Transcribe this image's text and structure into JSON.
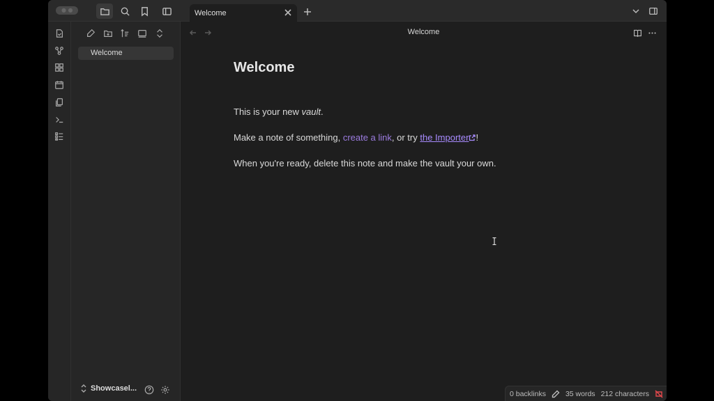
{
  "tabs": [
    {
      "label": "Welcome"
    }
  ],
  "sidebar": {
    "files": [
      {
        "label": "Welcome"
      }
    ],
    "vault_name": "Showcasel..."
  },
  "view": {
    "title": "Welcome"
  },
  "note": {
    "heading": "Welcome",
    "p1_prefix": "This is your new ",
    "p1_em": "vault",
    "p1_suffix": ".",
    "p2_prefix": "Make a note of something, ",
    "p2_link_internal": "create a link",
    "p2_mid": ", or try ",
    "p2_link_external": "the Importer",
    "p2_suffix": "!",
    "p3": "When you're ready, delete this note and make the vault your own."
  },
  "status": {
    "backlinks": "0 backlinks",
    "words": "35 words",
    "characters": "212 characters"
  },
  "icons": {
    "sync_status": "sync-off-icon"
  },
  "colors": {
    "accent": "#a88bff",
    "sync_off": "#e5484d"
  }
}
